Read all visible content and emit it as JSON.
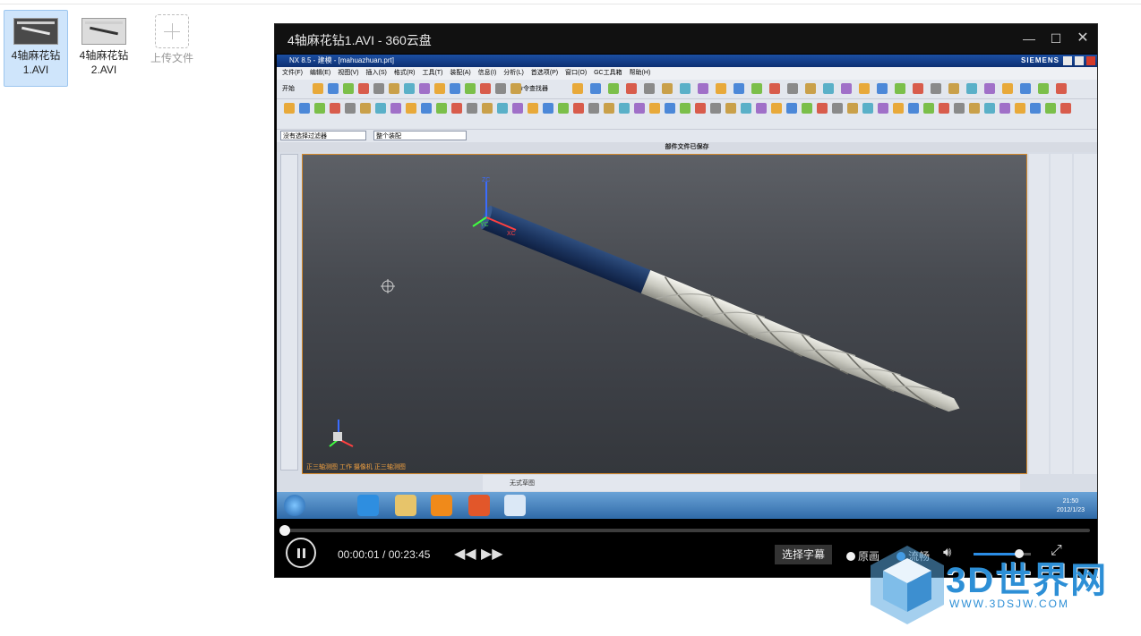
{
  "files": [
    {
      "name": "4轴麻花钻1.AVI",
      "selected": true
    },
    {
      "name": "4轴麻花钻2.AVI",
      "selected": false
    }
  ],
  "upload_label": "上传文件",
  "player": {
    "title": "4轴麻花钻1.AVI - 360云盘",
    "time": "00:00:01 / 00:23:45",
    "subtitle_button": "选择字幕",
    "quality_options": [
      "原画",
      "流畅"
    ],
    "quality_selected": "流畅",
    "progress_fraction": 0.0007,
    "volume_fraction": 0.8
  },
  "video_frame": {
    "app_title": "NX 8.5 - 建模 - [mahuazhuan.prt]",
    "brand": "SIEMENS",
    "menu": [
      "文件(F)",
      "编辑(E)",
      "视图(V)",
      "插入(S)",
      "格式(R)",
      "工具(T)",
      "装配(A)",
      "信息(I)",
      "分析(L)",
      "首选项(P)",
      "窗口(O)",
      "GC工具箱",
      "帮助(H)"
    ],
    "start_label": "开始",
    "command_finder": "命令查找器",
    "filter_select": "没有选择过滤器",
    "assembly_select": "整个装配",
    "status_message": "部件文件已保存",
    "viewport_caption": "正三轴测图 工作 摄像机 正三轴测图",
    "axis_labels": [
      "ZC",
      "YC",
      "XC"
    ],
    "bottom_toolbar_label": "无式草图",
    "clock_time": "21:50",
    "clock_date": "2012/1/23"
  },
  "watermark": {
    "text": "3D世界网",
    "url": "WWW.3DSJW.COM"
  },
  "colors": {
    "accent": "#2b8de6",
    "selected_file_bg": "#cfe5fb",
    "viewport_border": "#d58a2c"
  }
}
